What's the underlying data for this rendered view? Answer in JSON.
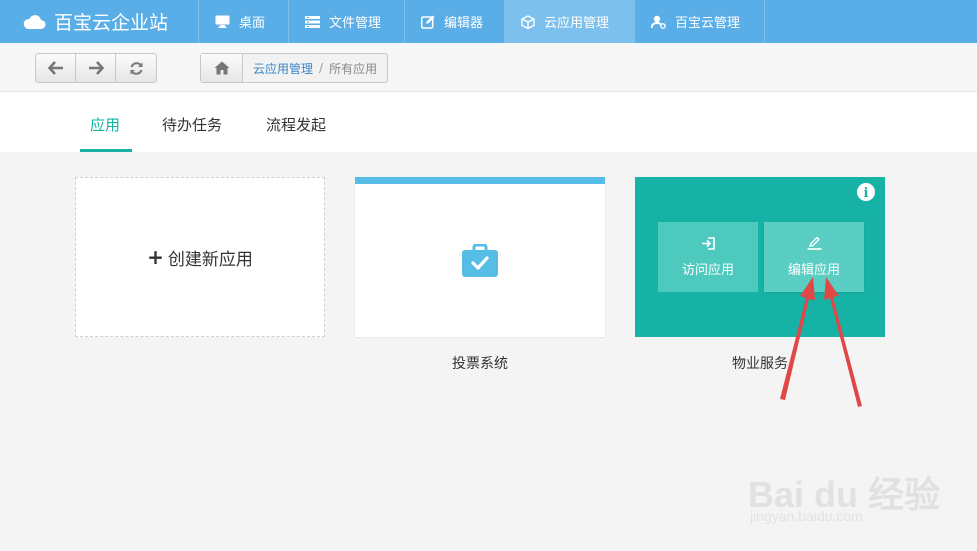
{
  "brand": {
    "title": "百宝云企业站",
    "icon": "cloud-icon"
  },
  "nav": [
    {
      "label": "桌面",
      "icon": "monitor-icon"
    },
    {
      "label": "文件管理",
      "icon": "file-list-icon"
    },
    {
      "label": "编辑器",
      "icon": "edit-icon"
    },
    {
      "label": "云应用管理",
      "icon": "cube-icon",
      "active": true
    },
    {
      "label": "百宝云管理",
      "icon": "user-settings-icon"
    }
  ],
  "toolbar": {
    "buttons": [
      "back-icon",
      "forward-icon",
      "refresh-icon"
    ],
    "breadcrumb": {
      "link": "云应用管理",
      "separator": "/",
      "current": "所有应用"
    }
  },
  "tabs": [
    {
      "label": "应用",
      "active": true
    },
    {
      "label": "待办任务"
    },
    {
      "label": "流程发起"
    }
  ],
  "cards": {
    "create": {
      "label": "创建新应用",
      "plus": "+"
    },
    "vote": {
      "label": "投票系统",
      "icon": "briefcase-check-icon"
    },
    "property": {
      "label": "物业服务",
      "visit_label": "访问应用",
      "edit_label": "编辑应用",
      "info": "i"
    }
  },
  "watermark": {
    "text": "Bai du 经验",
    "url": "jingyan.baidu.com"
  },
  "colors": {
    "nav": "#5aaee8",
    "accent": "#16b3a3",
    "card_teal": "#15b2a5",
    "vote_bar": "#55bde6",
    "arrow": "#e04848"
  }
}
